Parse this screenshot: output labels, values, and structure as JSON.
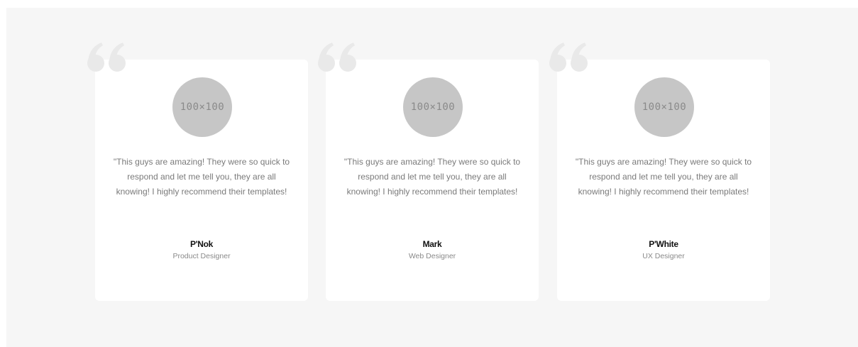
{
  "testimonials": {
    "quote_icon": "quote-icon",
    "quote_color": "#e9e9e9",
    "avatar_color": "#c6c6c6",
    "items": [
      {
        "avatar_label": "100×100",
        "quote": "\"This guys are amazing! They were so quick to respond and let me tell you, they are all knowing! I highly recommend their templates!",
        "name": "P'Nok",
        "role": "Product Designer"
      },
      {
        "avatar_label": "100×100",
        "quote": "\"This guys are amazing! They were so quick to respond and let me tell you, they are all knowing! I highly recommend their templates!",
        "name": "Mark",
        "role": "Web Designer"
      },
      {
        "avatar_label": "100×100",
        "quote": "\"This guys are amazing! They were so quick to respond and let me tell you, they are all knowing! I highly recommend their templates!",
        "name": "P'White",
        "role": "UX Designer"
      }
    ]
  }
}
